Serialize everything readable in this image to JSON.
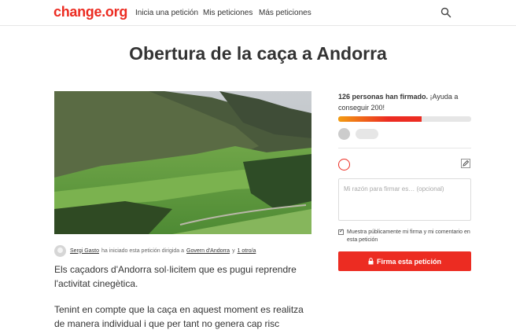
{
  "header": {
    "logo": "change.org",
    "nav": [
      "Inicia una petición",
      "Mis peticiones",
      "Más peticiones"
    ],
    "search_icon": "search-icon"
  },
  "petition": {
    "title": "Obertura de la caça a Andorra",
    "author": {
      "name": "Sergi Gasto",
      "text_mid": "ha iniciado esta petición dirigida a",
      "target": "Govern d'Andorra",
      "text_and": "y",
      "others": "1 otro/a"
    },
    "paragraphs": [
      "Els caçadors d'Andorra sol·licitem que es pugui reprendre l'activitat cinegètica.",
      "Tenint en compte que la caça en aquest moment es realitza de manera individual i que per tant no genera cap risc addicional a"
    ]
  },
  "sidebar": {
    "count_bold": "126 personas han firmado.",
    "count_rest": " ¡Ayuda a conseguir 200!",
    "signatures": 126,
    "goal": 200,
    "progress_fraction": 0.63,
    "reason_placeholder": "Mi razón para firmar es… (opcional)",
    "checkbox_label": "Muestra públicamente mi firma y mi comentario en esta petición",
    "checkbox_checked": true,
    "sign_button": "Firma esta petición",
    "colors": {
      "brand": "#ec2c22",
      "progress_start": "#f39c12"
    }
  }
}
